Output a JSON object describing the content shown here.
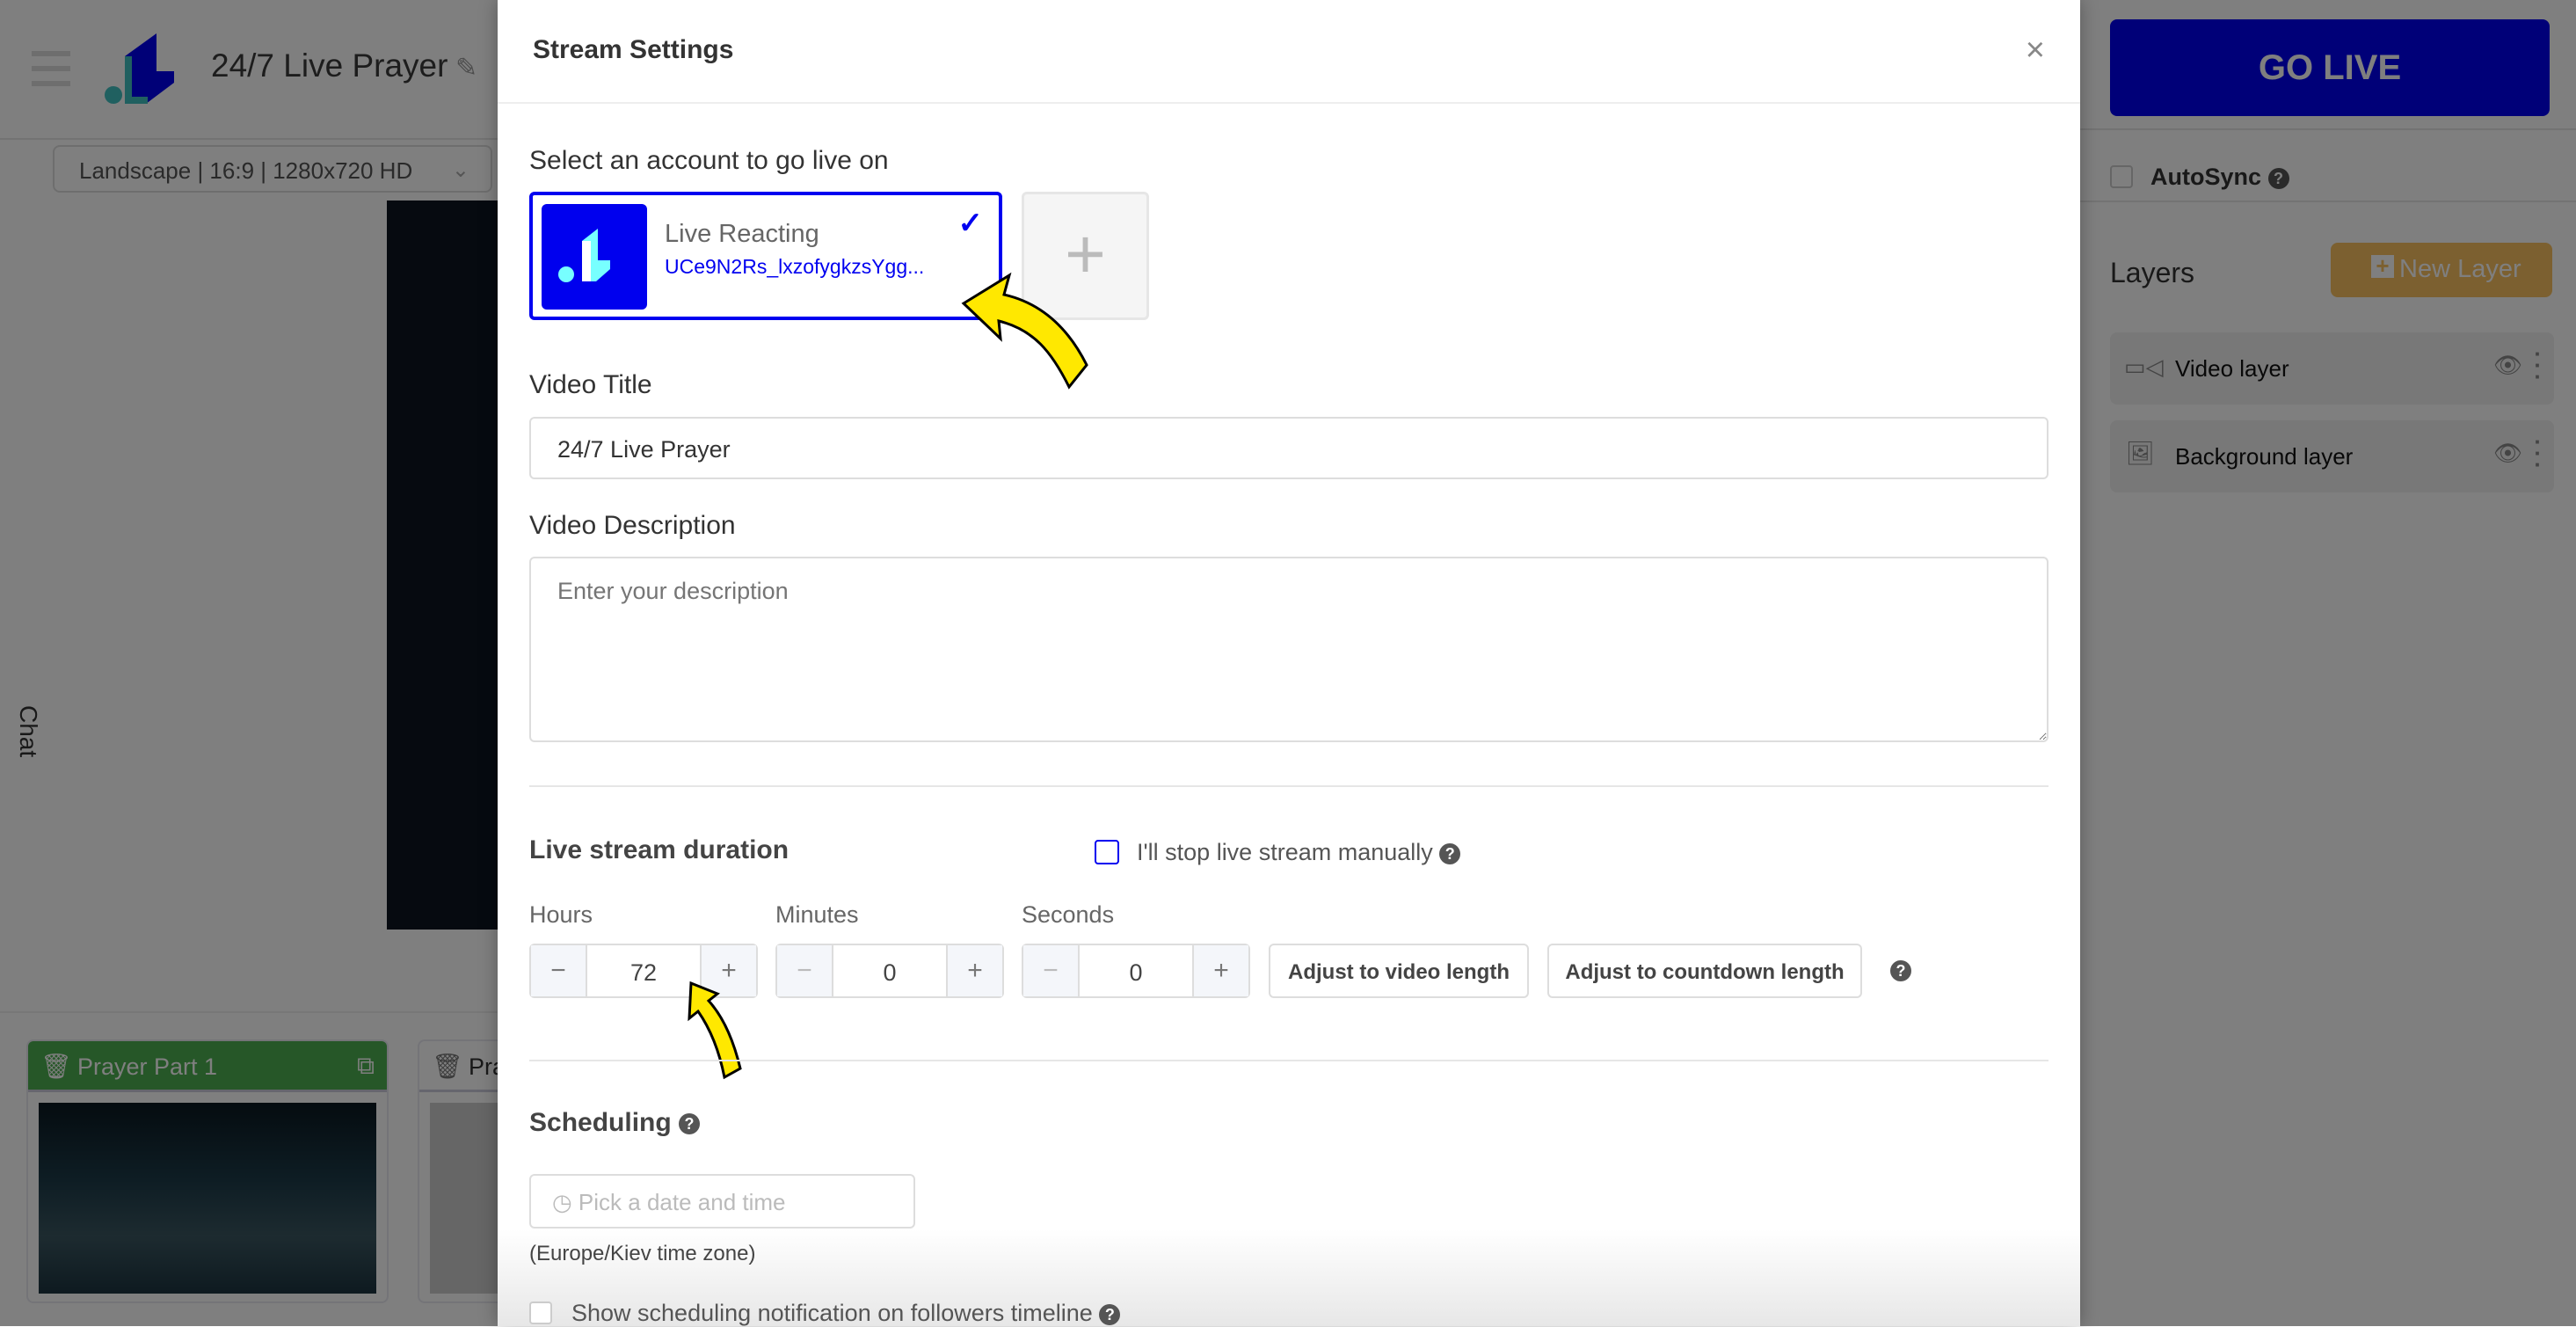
{
  "app": {
    "project_title": "24/7 Live Prayer",
    "resolution_select": "Landscape | 16:9 | 1280x720 HD",
    "chat_tab": "Chat",
    "scenes": [
      {
        "name": "Prayer Part 1",
        "color": "#4caf50"
      },
      {
        "name": "Pra"
      }
    ]
  },
  "right_panel": {
    "go_live": "GO LIVE",
    "autosync": "AutoSync",
    "layers_title": "Layers",
    "new_layer": "New Layer",
    "layers": [
      {
        "name": "Video layer",
        "icon": "video-camera-icon"
      },
      {
        "name": "Background layer",
        "icon": "image-icon"
      }
    ]
  },
  "modal": {
    "title": "Stream Settings",
    "account_section": "Select an account to go live on",
    "account": {
      "name": "Live Reacting",
      "id": "UCe9N2Rs_lxzofygkzsYgg...",
      "selected": true
    },
    "video_title_label": "Video Title",
    "video_title_value": "24/7 Live Prayer",
    "video_description_label": "Video Description",
    "video_description_placeholder": "Enter your description",
    "duration_title": "Live stream duration",
    "stop_manually": "I'll stop live stream manually",
    "hours_label": "Hours",
    "hours": "72",
    "minutes_label": "Minutes",
    "minutes": "0",
    "seconds_label": "Seconds",
    "seconds": "0",
    "minus": "−",
    "plus": "+",
    "adjust_video": "Adjust to video length",
    "adjust_countdown": "Adjust to countdown length",
    "scheduling_title": "Scheduling",
    "date_placeholder": "Pick a date and time",
    "timezone": "(Europe/Kiev time zone)",
    "show_notification": "Show scheduling notification on followers timeline"
  },
  "colors": {
    "accent": "#0000f0",
    "go_live": "#0000f0",
    "new_layer": "#f8c060",
    "annotation_arrow": "#ffe800"
  }
}
